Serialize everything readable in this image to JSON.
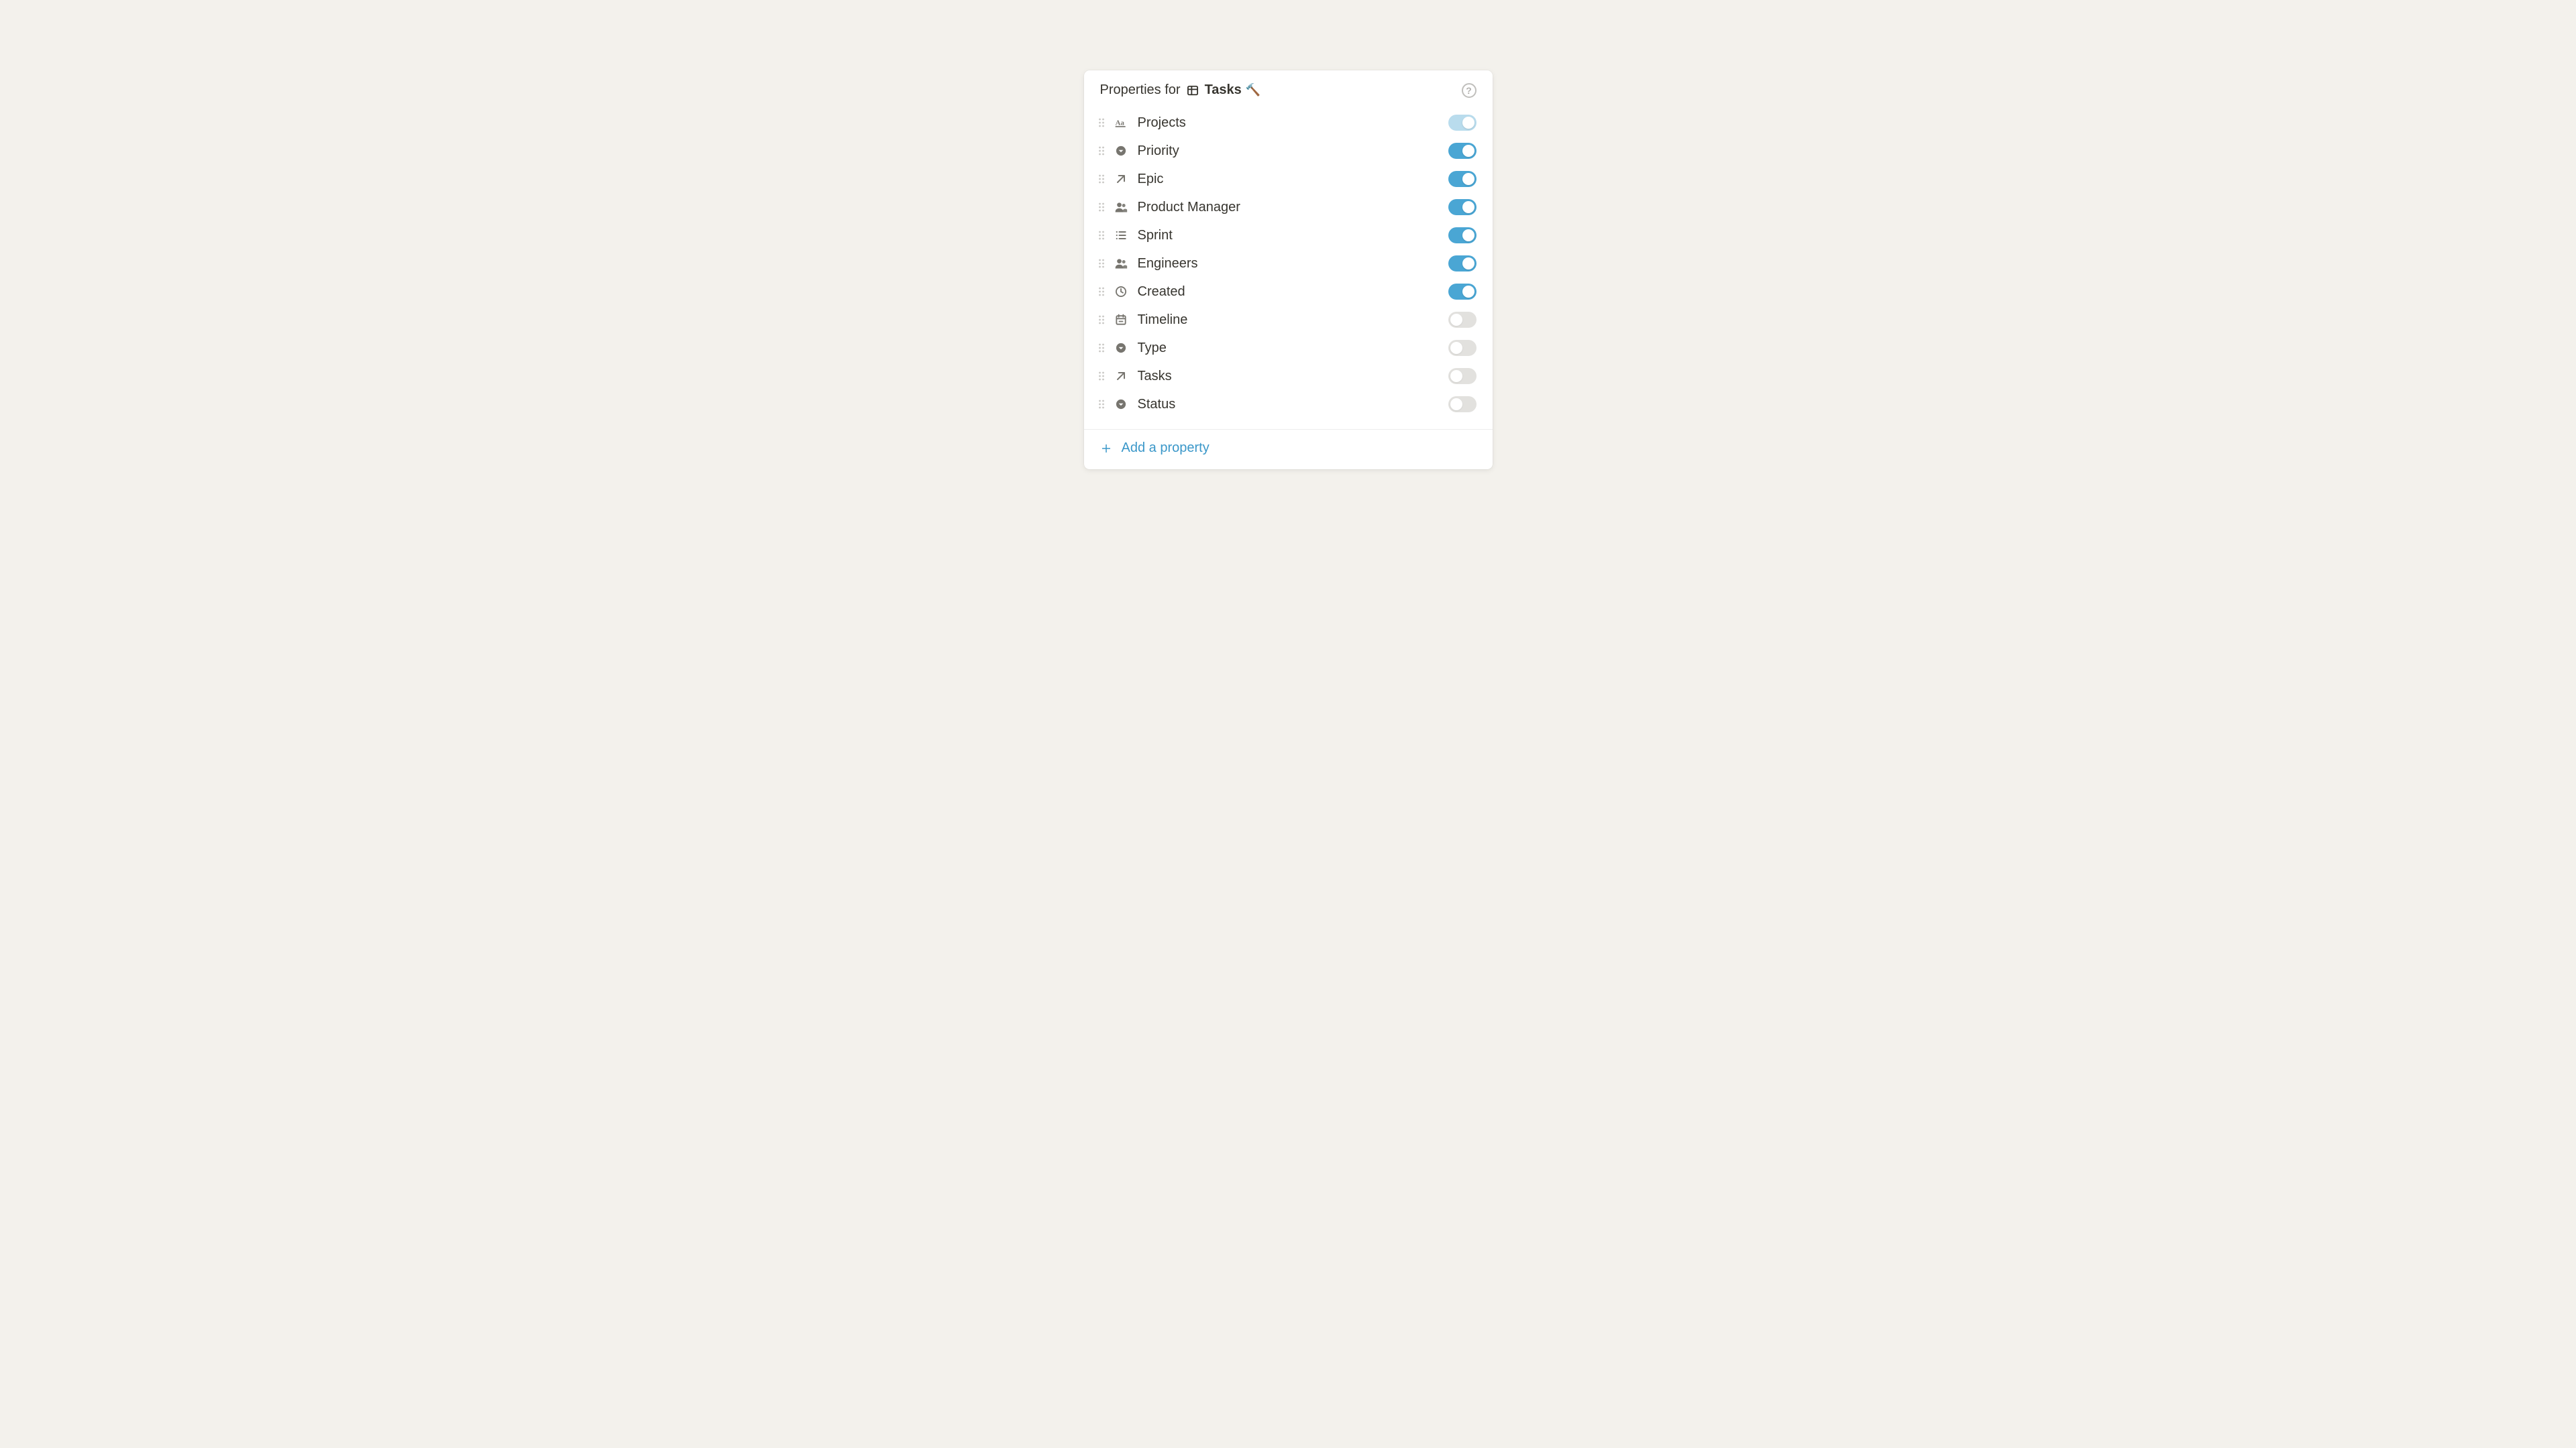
{
  "header": {
    "prefix": "Properties for",
    "db_name": "Tasks",
    "db_emoji": "🔨"
  },
  "properties": [
    {
      "icon": "text",
      "label": "Projects",
      "enabled": true,
      "locked": true
    },
    {
      "icon": "select",
      "label": "Priority",
      "enabled": true,
      "locked": false
    },
    {
      "icon": "arrow",
      "label": "Epic",
      "enabled": true,
      "locked": false
    },
    {
      "icon": "people",
      "label": "Product Manager",
      "enabled": true,
      "locked": false
    },
    {
      "icon": "list",
      "label": "Sprint",
      "enabled": true,
      "locked": false
    },
    {
      "icon": "people",
      "label": "Engineers",
      "enabled": true,
      "locked": false
    },
    {
      "icon": "clock",
      "label": "Created",
      "enabled": true,
      "locked": false
    },
    {
      "icon": "calendar",
      "label": "Timeline",
      "enabled": false,
      "locked": false
    },
    {
      "icon": "select",
      "label": "Type",
      "enabled": false,
      "locked": false
    },
    {
      "icon": "arrow",
      "label": "Tasks",
      "enabled": false,
      "locked": false
    },
    {
      "icon": "select",
      "label": "Status",
      "enabled": false,
      "locked": false
    }
  ],
  "footer": {
    "add_label": "Add a property"
  }
}
